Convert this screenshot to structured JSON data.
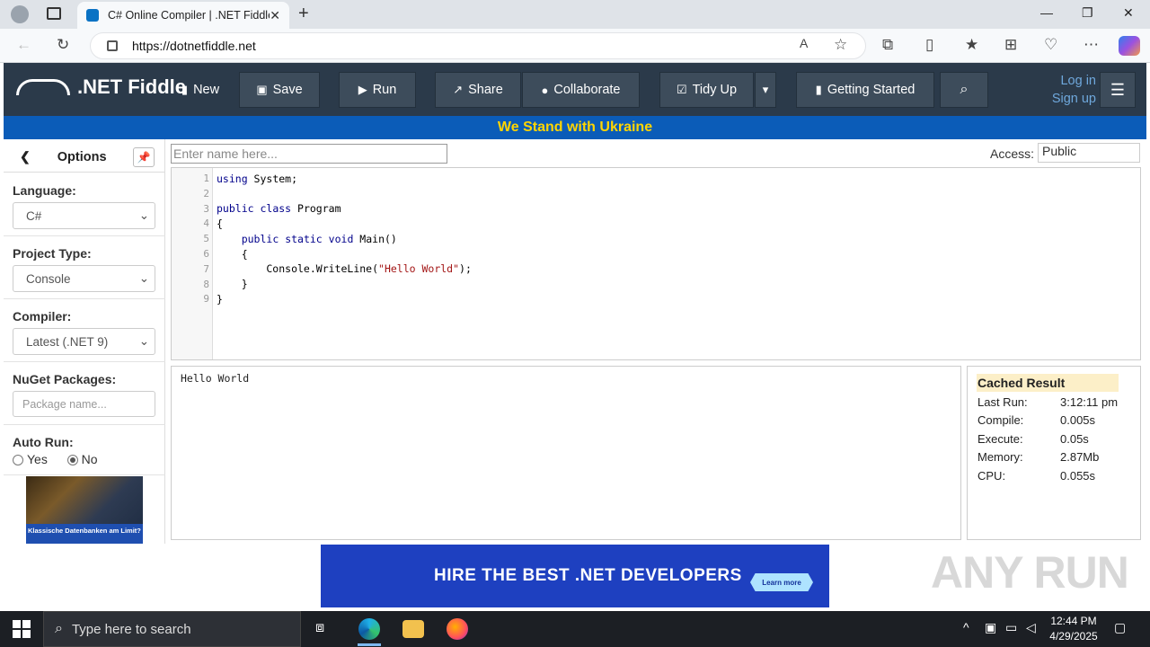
{
  "browser": {
    "tab_title": "C# Online Compiler | .NET Fiddle",
    "url": "https://dotnetfiddle.net",
    "tab_close": "✕",
    "new_tab": "+"
  },
  "header": {
    "logo_text": ".NET Fiddle",
    "buttons": {
      "new": "New",
      "save": "Save",
      "run": "Run",
      "share": "Share",
      "collaborate": "Collaborate",
      "tidy_up": "Tidy Up",
      "getting_started": "Getting Started"
    },
    "login": "Log in",
    "signup": "Sign up"
  },
  "ukraine_banner": "We Stand with Ukraine",
  "sidebar": {
    "title": "Options",
    "language_label": "Language:",
    "language_value": "C#",
    "project_label": "Project Type:",
    "project_value": "Console",
    "compiler_label": "Compiler:",
    "compiler_value": "Latest (.NET 9)",
    "nuget_label": "NuGet Packages:",
    "nuget_placeholder": "Package name...",
    "autorun_label": "Auto Run:",
    "autorun_yes": "Yes",
    "autorun_no": "No",
    "ad_caption": "Klassische Datenbanken am Limit?"
  },
  "editor": {
    "name_placeholder": "Enter name here...",
    "access_label": "Access:",
    "access_value": "Public",
    "line_numbers": [
      "1",
      "2",
      "3",
      "4",
      "5",
      "6",
      "7",
      "8",
      "9"
    ]
  },
  "output": {
    "text": "Hello World"
  },
  "stats": {
    "header": "Cached Result",
    "rows": [
      {
        "label": "Last Run:",
        "value": "3:12:11 pm"
      },
      {
        "label": "Compile:",
        "value": "0.005s"
      },
      {
        "label": "Execute:",
        "value": "0.05s"
      },
      {
        "label": "Memory:",
        "value": "2.87Mb"
      },
      {
        "label": "CPU:",
        "value": "0.055s"
      }
    ]
  },
  "ad_banner": {
    "text": "HIRE THE BEST .NET DEVELOPERS",
    "button": "Learn more"
  },
  "watermark": "ANY RUN",
  "taskbar": {
    "search_placeholder": "Type here to search",
    "time": "12:44 PM",
    "date": "4/29/2025"
  },
  "colors": {
    "header_bg": "#2b3a4a",
    "ukraine_bg": "#0b5cb8",
    "ukraine_text": "#ffd500",
    "banner_bg": "#1e40c0"
  }
}
